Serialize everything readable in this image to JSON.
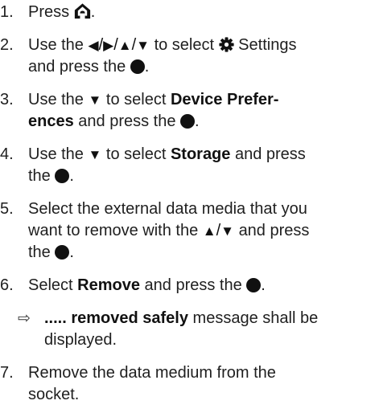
{
  "steps": [
    {
      "num": "1.",
      "a": "Press",
      "end": "."
    },
    {
      "num": "2.",
      "a": "Use the",
      "b": "to select",
      "c": "Settings",
      "d": "and press the",
      "end": "."
    },
    {
      "num": "3.",
      "a": "Use the",
      "b": "to select",
      "bold1": "Device Prefer-",
      "bold2": "ences",
      "c": "and press the",
      "end": "."
    },
    {
      "num": "4.",
      "a": "Use the",
      "b": "to select",
      "bold": "Storage",
      "c": "and press",
      "d": "the",
      "end": "."
    },
    {
      "num": "5.",
      "a": "Select the external data media that you",
      "b": "want to remove with the",
      "c": "and press",
      "d": "the",
      "end": "."
    },
    {
      "num": "6.",
      "a": "Select",
      "bold": "Remove",
      "b": "and press the",
      "end": "."
    },
    {
      "num": "7.",
      "a": "Remove the data medium from the",
      "b": "socket."
    }
  ],
  "result": {
    "bold": "..... removed safely",
    "a": "message shall be",
    "b": "displayed."
  },
  "icons": {
    "home": "home-icon",
    "gear": "gear-icon",
    "ok": "ok-button-icon",
    "arrows": [
      "left-arrow-icon",
      "right-arrow-icon",
      "up-arrow-icon",
      "down-arrow-icon"
    ]
  }
}
